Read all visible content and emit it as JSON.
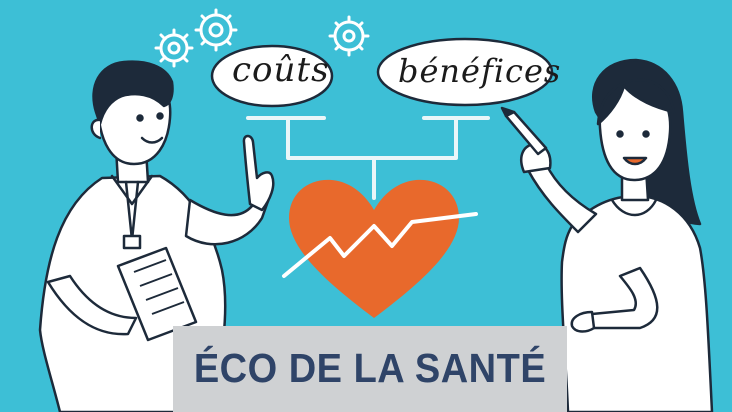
{
  "bubbles": {
    "left": "coûts",
    "right": "bénéfices"
  },
  "banner": {
    "title": "ÉCO DE LA SANTÉ"
  },
  "icons": [
    "gear-icon",
    "heart-icon",
    "pen-icon",
    "document-icon"
  ],
  "colors": {
    "background": "#3dbfd6",
    "heart": "#e8692c",
    "banner_bg": "#cfd1d3",
    "banner_text": "#2f4468",
    "outline": "#1d2a3a",
    "scale_lines": "#e9f6f9"
  }
}
